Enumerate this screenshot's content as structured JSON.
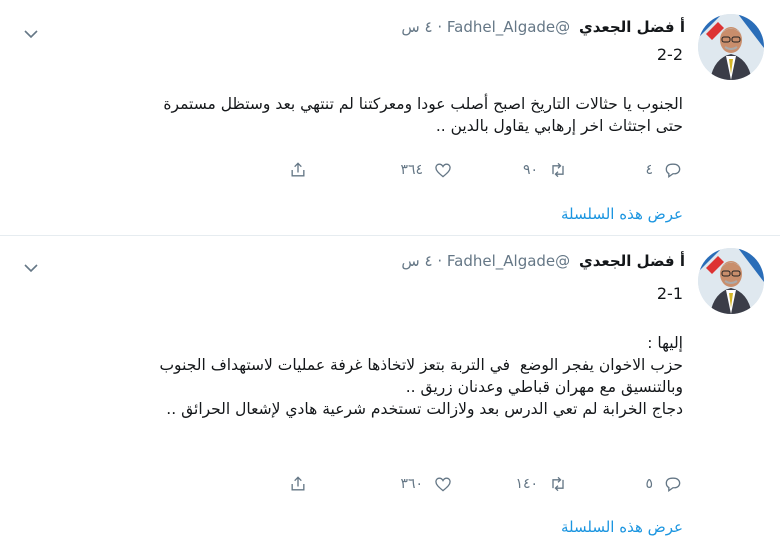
{
  "tweets": [
    {
      "name": "أ فضل الجعدي",
      "handle": "@Fadhel_Algade",
      "dot": "·",
      "time": "٤ س",
      "thread": "2-2",
      "body": [
        "الجنوب يا حثالات التاريخ اصبح أصلب عودا ومعركتنا لم تنتهي بعد وستظل مستمرة",
        "حتى اجتثاث اخر إرهابي يقاول بالدين .."
      ],
      "replies": "٤",
      "retweets": "٩٠",
      "likes": "٣٦٤",
      "show_thread": "عرض هذه السلسلة"
    },
    {
      "name": "أ فضل الجعدي",
      "handle": "@Fadhel_Algade",
      "dot": "·",
      "time": "٤ س",
      "thread": "2-1",
      "body": [
        "إليها :",
        "",
        "حزب الاخوان يفجر الوضع  في التربة بتعز لاتخاذها غرفة عمليات لاستهداف الجنوب",
        "وبالتنسيق مع مهران قباطي وعدنان زريق ..",
        "دجاج الخرابة لم تعي الدرس بعد ولازالت تستخدم شرعية هادي لإشعال الحرائق .."
      ],
      "replies": "٥",
      "retweets": "١٤٠",
      "likes": "٣٦٠",
      "show_thread": "عرض هذه السلسلة"
    }
  ],
  "icons": {
    "avatar": "avatar-photo",
    "more": "chevron-down-icon",
    "reply": "reply-icon",
    "retweet": "retweet-icon",
    "like": "heart-icon",
    "share": "share-icon"
  },
  "colors": {
    "link": "#1b95e0",
    "muted": "#657786",
    "separator": "#e6ecf0"
  }
}
